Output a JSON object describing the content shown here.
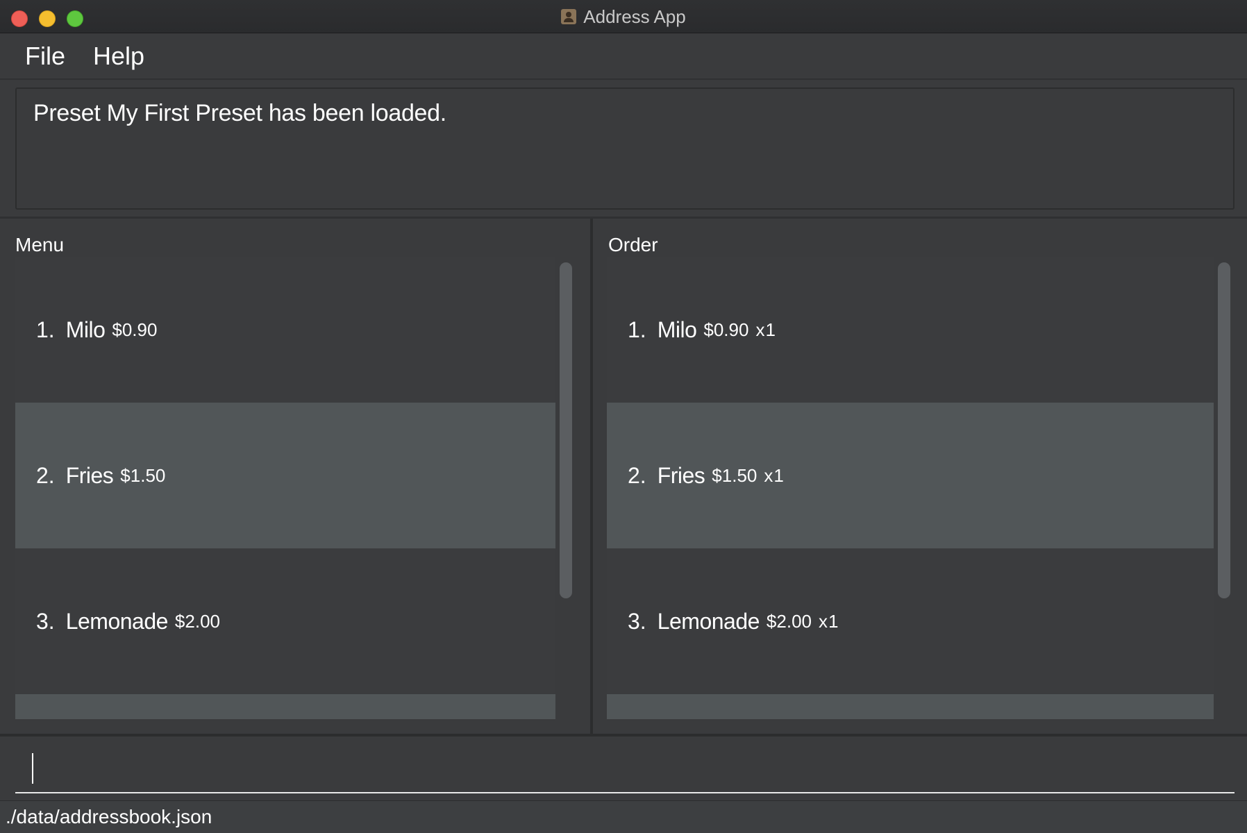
{
  "window": {
    "title": "Address App",
    "controls": [
      "close",
      "minimize",
      "maximize"
    ]
  },
  "menubar": {
    "items": [
      {
        "label": "File"
      },
      {
        "label": "Help"
      }
    ]
  },
  "result": {
    "message": "Preset My First Preset has been loaded."
  },
  "menu_panel": {
    "title": "Menu",
    "items": [
      {
        "index": "1.",
        "name": "Milo",
        "price": "$0.90"
      },
      {
        "index": "2.",
        "name": "Fries",
        "price": "$1.50"
      },
      {
        "index": "3.",
        "name": "Lemonade",
        "price": "$2.00"
      }
    ]
  },
  "order_panel": {
    "title": "Order",
    "items": [
      {
        "index": "1.",
        "name": "Milo",
        "price": "$0.90",
        "qty": "x1"
      },
      {
        "index": "2.",
        "name": "Fries",
        "price": "$1.50",
        "qty": "x1"
      },
      {
        "index": "3.",
        "name": "Lemonade",
        "price": "$2.00",
        "qty": "x1"
      }
    ]
  },
  "command": {
    "value": "",
    "placeholder": ""
  },
  "status": {
    "file_path": "./data/addressbook.json"
  },
  "colors": {
    "background": "#3a3b3d",
    "row_dark": "#3b3c3e",
    "row_light": "#515658",
    "close": "#ee5f57",
    "minimize": "#f5be2f",
    "maximize": "#5ec73f"
  }
}
